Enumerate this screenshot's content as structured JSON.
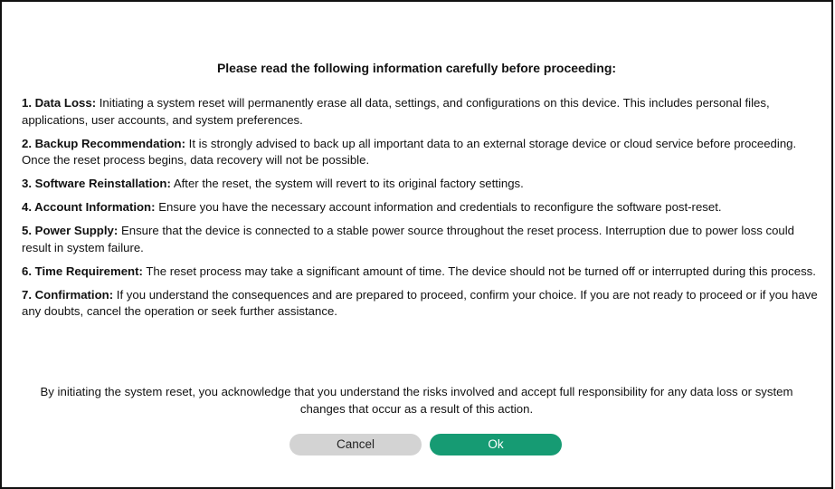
{
  "dialog": {
    "heading": "Please read the following information carefully before proceeding:",
    "items": [
      {
        "title": "1. Data Loss:",
        "text": "Initiating a system reset will permanently erase all data, settings, and configurations on this device. This includes personal files, applications, user accounts, and system preferences."
      },
      {
        "title": "2. Backup Recommendation:",
        "text": "It is strongly advised to back up all important data to an external storage device or cloud service before proceeding. Once the reset process begins, data recovery will not be possible."
      },
      {
        "title": "3. Software Reinstallation:",
        "text": "After the reset, the system will revert to its original factory settings."
      },
      {
        "title": "4. Account Information:",
        "text": "Ensure you have the necessary account information and credentials to reconfigure the software post-reset."
      },
      {
        "title": "5. Power Supply:",
        "text": "Ensure that the device is connected to a stable power source throughout the reset process. Interruption due to power loss could result in system failure."
      },
      {
        "title": "6. Time Requirement:",
        "text": "The reset process may take a significant amount of time. The device should not be turned off or interrupted during this process."
      },
      {
        "title": "7. Confirmation:",
        "text": "If you understand the consequences and are prepared to proceed, confirm your choice. If you are not ready to proceed or if you have any doubts, cancel the operation or seek further assistance."
      }
    ],
    "acknowledgement": "By initiating the system reset, you acknowledge that you understand the risks involved and accept full responsibility for any data loss or system changes that occur as a result of this action.",
    "cancel_label": "Cancel",
    "ok_label": "Ok"
  },
  "colors": {
    "ok_button": "#169b73",
    "cancel_button": "#d3d3d3",
    "border": "#111111"
  }
}
